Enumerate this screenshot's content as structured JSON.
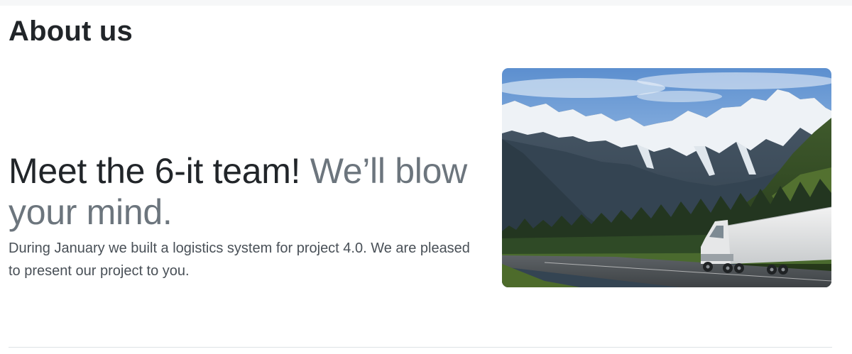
{
  "page": {
    "title": "About us"
  },
  "hero": {
    "headline_primary": "Meet the 6-it team!",
    "headline_secondary": "We’ll blow your mind.",
    "lead": "During January we built a logistics system for project 4.0. We are pleased to present our project to you."
  },
  "colors": {
    "text": "#212529",
    "muted": "#6c757d",
    "divider": "#dee2e6"
  }
}
